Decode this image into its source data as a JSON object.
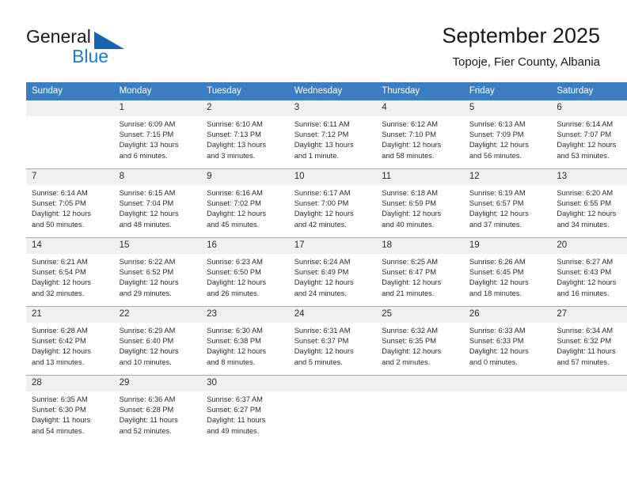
{
  "brand": {
    "name_top": "General",
    "name_bottom": "Blue",
    "accent_color": "#1a7fd4",
    "triangle_color": "#1565b0"
  },
  "header": {
    "title": "September 2025",
    "subtitle": "Topoje, Fier County, Albania"
  },
  "theme": {
    "header_bar_color": "#3b7dc0",
    "daynum_band_color": "#f0f0f0",
    "grid_line_color": "#a9a9a9",
    "text_color": "#2b2b2b"
  },
  "weekdays": [
    "Sunday",
    "Monday",
    "Tuesday",
    "Wednesday",
    "Thursday",
    "Friday",
    "Saturday"
  ],
  "labels": {
    "sunrise": "Sunrise:",
    "sunset": "Sunset:",
    "daylight": "Daylight:"
  },
  "weeks": [
    [
      {
        "day": "",
        "sunrise": "",
        "sunset": "",
        "daylight_1": "",
        "daylight_2": ""
      },
      {
        "day": "1",
        "sunrise": "Sunrise: 6:09 AM",
        "sunset": "Sunset: 7:15 PM",
        "daylight_1": "Daylight: 13 hours",
        "daylight_2": "and 6 minutes."
      },
      {
        "day": "2",
        "sunrise": "Sunrise: 6:10 AM",
        "sunset": "Sunset: 7:13 PM",
        "daylight_1": "Daylight: 13 hours",
        "daylight_2": "and 3 minutes."
      },
      {
        "day": "3",
        "sunrise": "Sunrise: 6:11 AM",
        "sunset": "Sunset: 7:12 PM",
        "daylight_1": "Daylight: 13 hours",
        "daylight_2": "and 1 minute."
      },
      {
        "day": "4",
        "sunrise": "Sunrise: 6:12 AM",
        "sunset": "Sunset: 7:10 PM",
        "daylight_1": "Daylight: 12 hours",
        "daylight_2": "and 58 minutes."
      },
      {
        "day": "5",
        "sunrise": "Sunrise: 6:13 AM",
        "sunset": "Sunset: 7:09 PM",
        "daylight_1": "Daylight: 12 hours",
        "daylight_2": "and 56 minutes."
      },
      {
        "day": "6",
        "sunrise": "Sunrise: 6:14 AM",
        "sunset": "Sunset: 7:07 PM",
        "daylight_1": "Daylight: 12 hours",
        "daylight_2": "and 53 minutes."
      }
    ],
    [
      {
        "day": "7",
        "sunrise": "Sunrise: 6:14 AM",
        "sunset": "Sunset: 7:05 PM",
        "daylight_1": "Daylight: 12 hours",
        "daylight_2": "and 50 minutes."
      },
      {
        "day": "8",
        "sunrise": "Sunrise: 6:15 AM",
        "sunset": "Sunset: 7:04 PM",
        "daylight_1": "Daylight: 12 hours",
        "daylight_2": "and 48 minutes."
      },
      {
        "day": "9",
        "sunrise": "Sunrise: 6:16 AM",
        "sunset": "Sunset: 7:02 PM",
        "daylight_1": "Daylight: 12 hours",
        "daylight_2": "and 45 minutes."
      },
      {
        "day": "10",
        "sunrise": "Sunrise: 6:17 AM",
        "sunset": "Sunset: 7:00 PM",
        "daylight_1": "Daylight: 12 hours",
        "daylight_2": "and 42 minutes."
      },
      {
        "day": "11",
        "sunrise": "Sunrise: 6:18 AM",
        "sunset": "Sunset: 6:59 PM",
        "daylight_1": "Daylight: 12 hours",
        "daylight_2": "and 40 minutes."
      },
      {
        "day": "12",
        "sunrise": "Sunrise: 6:19 AM",
        "sunset": "Sunset: 6:57 PM",
        "daylight_1": "Daylight: 12 hours",
        "daylight_2": "and 37 minutes."
      },
      {
        "day": "13",
        "sunrise": "Sunrise: 6:20 AM",
        "sunset": "Sunset: 6:55 PM",
        "daylight_1": "Daylight: 12 hours",
        "daylight_2": "and 34 minutes."
      }
    ],
    [
      {
        "day": "14",
        "sunrise": "Sunrise: 6:21 AM",
        "sunset": "Sunset: 6:54 PM",
        "daylight_1": "Daylight: 12 hours",
        "daylight_2": "and 32 minutes."
      },
      {
        "day": "15",
        "sunrise": "Sunrise: 6:22 AM",
        "sunset": "Sunset: 6:52 PM",
        "daylight_1": "Daylight: 12 hours",
        "daylight_2": "and 29 minutes."
      },
      {
        "day": "16",
        "sunrise": "Sunrise: 6:23 AM",
        "sunset": "Sunset: 6:50 PM",
        "daylight_1": "Daylight: 12 hours",
        "daylight_2": "and 26 minutes."
      },
      {
        "day": "17",
        "sunrise": "Sunrise: 6:24 AM",
        "sunset": "Sunset: 6:49 PM",
        "daylight_1": "Daylight: 12 hours",
        "daylight_2": "and 24 minutes."
      },
      {
        "day": "18",
        "sunrise": "Sunrise: 6:25 AM",
        "sunset": "Sunset: 6:47 PM",
        "daylight_1": "Daylight: 12 hours",
        "daylight_2": "and 21 minutes."
      },
      {
        "day": "19",
        "sunrise": "Sunrise: 6:26 AM",
        "sunset": "Sunset: 6:45 PM",
        "daylight_1": "Daylight: 12 hours",
        "daylight_2": "and 18 minutes."
      },
      {
        "day": "20",
        "sunrise": "Sunrise: 6:27 AM",
        "sunset": "Sunset: 6:43 PM",
        "daylight_1": "Daylight: 12 hours",
        "daylight_2": "and 16 minutes."
      }
    ],
    [
      {
        "day": "21",
        "sunrise": "Sunrise: 6:28 AM",
        "sunset": "Sunset: 6:42 PM",
        "daylight_1": "Daylight: 12 hours",
        "daylight_2": "and 13 minutes."
      },
      {
        "day": "22",
        "sunrise": "Sunrise: 6:29 AM",
        "sunset": "Sunset: 6:40 PM",
        "daylight_1": "Daylight: 12 hours",
        "daylight_2": "and 10 minutes."
      },
      {
        "day": "23",
        "sunrise": "Sunrise: 6:30 AM",
        "sunset": "Sunset: 6:38 PM",
        "daylight_1": "Daylight: 12 hours",
        "daylight_2": "and 8 minutes."
      },
      {
        "day": "24",
        "sunrise": "Sunrise: 6:31 AM",
        "sunset": "Sunset: 6:37 PM",
        "daylight_1": "Daylight: 12 hours",
        "daylight_2": "and 5 minutes."
      },
      {
        "day": "25",
        "sunrise": "Sunrise: 6:32 AM",
        "sunset": "Sunset: 6:35 PM",
        "daylight_1": "Daylight: 12 hours",
        "daylight_2": "and 2 minutes."
      },
      {
        "day": "26",
        "sunrise": "Sunrise: 6:33 AM",
        "sunset": "Sunset: 6:33 PM",
        "daylight_1": "Daylight: 12 hours",
        "daylight_2": "and 0 minutes."
      },
      {
        "day": "27",
        "sunrise": "Sunrise: 6:34 AM",
        "sunset": "Sunset: 6:32 PM",
        "daylight_1": "Daylight: 11 hours",
        "daylight_2": "and 57 minutes."
      }
    ],
    [
      {
        "day": "28",
        "sunrise": "Sunrise: 6:35 AM",
        "sunset": "Sunset: 6:30 PM",
        "daylight_1": "Daylight: 11 hours",
        "daylight_2": "and 54 minutes."
      },
      {
        "day": "29",
        "sunrise": "Sunrise: 6:36 AM",
        "sunset": "Sunset: 6:28 PM",
        "daylight_1": "Daylight: 11 hours",
        "daylight_2": "and 52 minutes."
      },
      {
        "day": "30",
        "sunrise": "Sunrise: 6:37 AM",
        "sunset": "Sunset: 6:27 PM",
        "daylight_1": "Daylight: 11 hours",
        "daylight_2": "and 49 minutes."
      },
      {
        "day": "",
        "sunrise": "",
        "sunset": "",
        "daylight_1": "",
        "daylight_2": ""
      },
      {
        "day": "",
        "sunrise": "",
        "sunset": "",
        "daylight_1": "",
        "daylight_2": ""
      },
      {
        "day": "",
        "sunrise": "",
        "sunset": "",
        "daylight_1": "",
        "daylight_2": ""
      },
      {
        "day": "",
        "sunrise": "",
        "sunset": "",
        "daylight_1": "",
        "daylight_2": ""
      }
    ]
  ]
}
